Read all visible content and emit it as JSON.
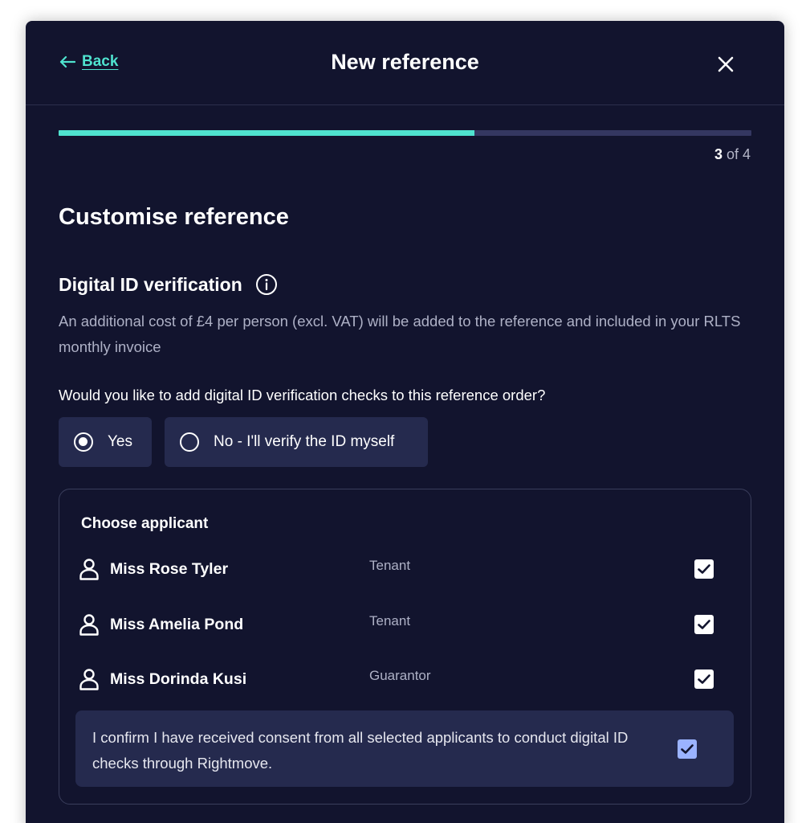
{
  "header": {
    "back_label": "Back",
    "title": "New reference",
    "close_icon": "close-icon"
  },
  "progress": {
    "fraction": 0.6,
    "current_step": "3",
    "of_text": " of 4"
  },
  "page": {
    "heading": "Customise reference"
  },
  "section": {
    "title": "Digital ID verification",
    "info_icon": "info-icon",
    "description": "An additional cost of £4 per person (excl. VAT) will be added to the reference and included in your RLTS monthly invoice",
    "question": "Would you like to add digital ID verification checks to this reference order?",
    "options": [
      {
        "label": "Yes",
        "selected": true
      },
      {
        "label": "No - I'll verify the ID myself",
        "selected": false
      }
    ]
  },
  "applicants": {
    "title": "Choose applicant",
    "items": [
      {
        "name": "Miss Rose Tyler",
        "role": "Tenant",
        "checked": true
      },
      {
        "name": "Miss Amelia Pond",
        "role": "Tenant",
        "checked": true
      },
      {
        "name": "Miss Dorinda Kusi",
        "role": "Guarantor",
        "checked": true
      }
    ],
    "consent_text": "I confirm I have received consent from all selected applicants to conduct digital ID checks through Rightmove.",
    "consent_checked": true
  },
  "colors": {
    "background": "#12142e",
    "accent": "#4fe3cf",
    "panel": "#252a4e",
    "consent_checkbox": "#9bb3ff"
  }
}
